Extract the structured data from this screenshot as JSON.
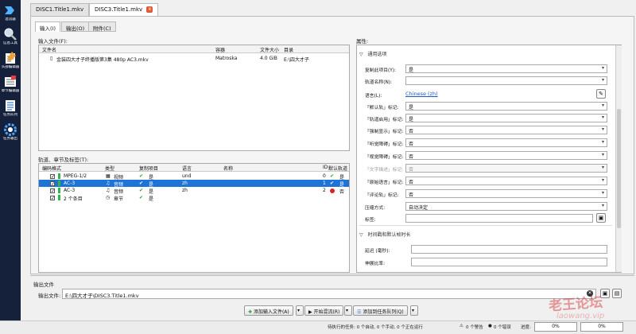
{
  "sidebar": {
    "items": [
      {
        "label": "混流器",
        "icon": "mux-arrow-icon"
      },
      {
        "label": "信息工具",
        "icon": "magnifier-icon"
      },
      {
        "label": "头部编辑器",
        "icon": "header-edit-icon"
      },
      {
        "label": "章节编辑器",
        "icon": "chapter-edit-icon"
      },
      {
        "label": "任务队列",
        "icon": "job-queue-icon"
      },
      {
        "label": "任务输出",
        "icon": "gear-icon"
      }
    ]
  },
  "file_tabs": [
    {
      "label": "DISC1.Title1.mkv"
    },
    {
      "label": "DISC3.Title1.mkv",
      "close": "x"
    }
  ],
  "sub_tabs": [
    "输入(I)",
    "输出(O)",
    "附件(C)"
  ],
  "input_files": {
    "label": "输入文件(F):",
    "headers": [
      "文件名",
      "容器",
      "文件大小",
      "目录"
    ],
    "rows": [
      {
        "name": "金装四大才子终播版第3集 480p AC3.mkv",
        "container": "Matroska",
        "size": "4.0 GiB",
        "dir": "E:\\四大才子"
      }
    ]
  },
  "tracks": {
    "label": "轨道、章节及标签(T):",
    "headers": [
      "编码格式",
      "类型",
      "复制项目",
      "语言",
      "名称",
      "ID",
      "默认轨道"
    ],
    "rows": [
      {
        "codec": "MPEG-1/2",
        "type": "视频",
        "copy": "是",
        "lang": "und",
        "name": "",
        "id": "0",
        "default": "是",
        "default_ok": true,
        "selected": false
      },
      {
        "codec": "AC-3",
        "type": "音频",
        "copy": "是",
        "lang": "zh",
        "name": "",
        "id": "1",
        "default": "是",
        "default_ok": true,
        "selected": true
      },
      {
        "codec": "AC-3",
        "type": "音频",
        "copy": "是",
        "lang": "zh",
        "name": "",
        "id": "2",
        "default": "否",
        "default_ok": false,
        "selected": false
      },
      {
        "codec": "2 个条目",
        "type": "章节",
        "copy": "是",
        "lang": "",
        "name": "",
        "id": "",
        "default": "",
        "default_ok": null,
        "selected": false
      }
    ]
  },
  "properties": {
    "label": "属性:",
    "general_section": "通用选项",
    "fields": [
      {
        "label": "复制此项目(Y):",
        "value": "是",
        "kind": "select",
        "dim": false
      },
      {
        "label": "轨道名称(N):",
        "value": "",
        "kind": "select",
        "dim": false
      },
      {
        "label": "语言(L):",
        "value": "Chinese (zh)",
        "kind": "link",
        "dim": false
      },
      {
        "label": "「默认轨」标记:",
        "value": "是",
        "kind": "select",
        "dim": false
      },
      {
        "label": "「轨道启用」标记:",
        "value": "是",
        "kind": "select",
        "dim": false
      },
      {
        "label": "「强制显示」标记:",
        "value": "否",
        "kind": "select",
        "dim": false
      },
      {
        "label": "「听觉障碍」标记:",
        "value": "否",
        "kind": "select",
        "dim": false
      },
      {
        "label": "「视觉障碍」标记:",
        "value": "否",
        "kind": "select",
        "dim": false
      },
      {
        "label": "「文字描述」标记:",
        "value": "否",
        "kind": "select",
        "dim": true
      },
      {
        "label": "「原始语言」标记:",
        "value": "否",
        "kind": "select",
        "dim": false
      },
      {
        "label": "「评论轨」标记:",
        "value": "否",
        "kind": "select",
        "dim": false
      },
      {
        "label": "压缩方式:",
        "value": "自动决定",
        "kind": "select",
        "dim": false
      },
      {
        "label": "标签:",
        "value": "",
        "kind": "input",
        "dim": false
      }
    ],
    "timing_section": "时间戳和默认帧时长",
    "timing_fields": [
      {
        "label": "延迟 (毫秒):",
        "value": ""
      },
      {
        "label": "伸展比率:",
        "value": ""
      }
    ]
  },
  "output": {
    "section_label": "输出文件",
    "label": "输出文件:",
    "value": "E:\\四大才子\\DISC3.Title1.mkv"
  },
  "actions": {
    "add_input": "添加输入文件(A)",
    "start_mux": "开始混流(R)",
    "add_to_queue": "添加到任务队列(Q)"
  },
  "status": {
    "pending": "待执行的任务: 0 个自动, 0 个手动, 0 个正在运行",
    "warnings": "0 个警告",
    "errors": "0 个错误",
    "progress_label": "进度:",
    "progress1": "0%",
    "progress2": "0%"
  },
  "watermark": {
    "text": "老王论坛",
    "sub": "laowang.vip"
  },
  "colors": {
    "sidebar_bg": "#15213b",
    "selection": "#1e74d6",
    "tab_close": "#e05a3a",
    "check_green": "#2a9b3a"
  }
}
